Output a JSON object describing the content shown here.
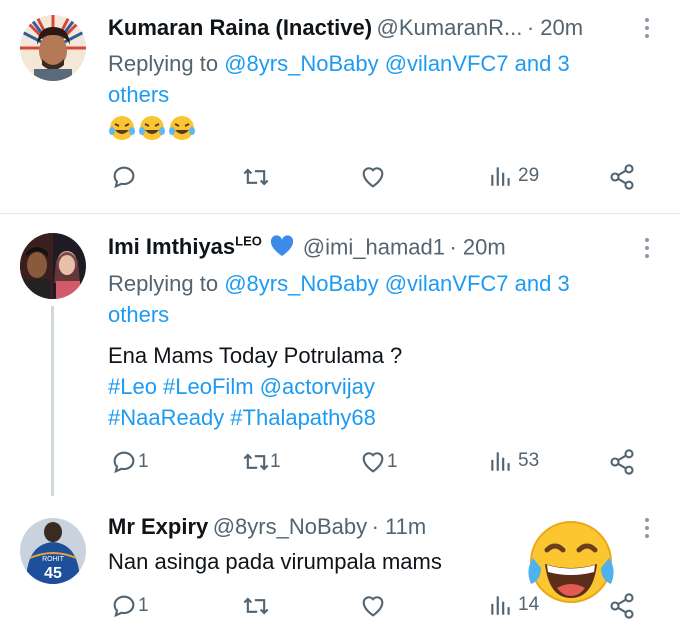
{
  "tweets": [
    {
      "name": "Kumaran Raina (Inactive)",
      "handle": "@KumaranR...",
      "time": "· 20m",
      "reply_prefix": "Replying to",
      "reply_users": "@8yrs_NoBaby @vilanVFC7",
      "reply_suffix": "and 3",
      "reply_suffix2": "others",
      "text": "😂😂😂",
      "stats": {
        "replies": "",
        "retweets": "",
        "likes": "",
        "views": "29"
      }
    },
    {
      "name": "Imi Imthiyas",
      "name_sup": "LEO",
      "handle": "@imi_hamad1",
      "time": "· 20m",
      "reply_prefix": "Replying to",
      "reply_users": "@8yrs_NoBaby @vilanVFC7",
      "reply_suffix": "and 3",
      "reply_suffix2": "others",
      "text_line1": "Ena Mams Today Potrulama ?",
      "tags_line2": "#Leo #LeoFilm @actorvijay",
      "tags_line3": "#NaaReady #Thalapathy68",
      "stats": {
        "replies": "1",
        "retweets": "1",
        "likes": "1",
        "views": "53"
      }
    },
    {
      "name": "Mr Expiry",
      "handle": "@8yrs_NoBaby",
      "time": "· 11m",
      "text": "Nan asinga pada virumpala mams",
      "jersey_name": "ROHIT",
      "jersey_number": "45",
      "stats": {
        "replies": "1",
        "retweets": "",
        "likes": "",
        "views": "14"
      }
    }
  ],
  "colors": {
    "link": "#1d9bf0",
    "muted": "#536471",
    "heart_blue": "#1d9bf0"
  }
}
